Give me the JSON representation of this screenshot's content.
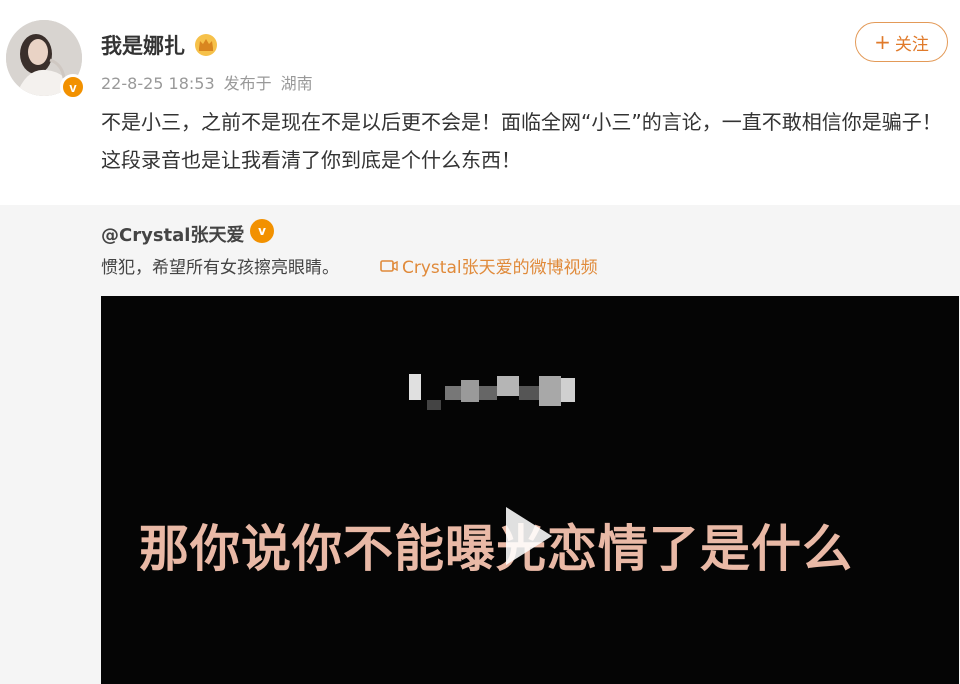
{
  "post": {
    "username": "我是娜扎",
    "timestamp": "22-8-25 18:53",
    "source": "发布于",
    "location": "湖南",
    "follow_plus": "+",
    "follow_label": "关注",
    "verified_mark": "v",
    "text": "不是小三，之前不是现在不是以后更不会是！面临全网“小三”的言论，一直不敢相信你是骗子！这段录音也是让我看清了你到底是个什么东西！"
  },
  "retweet": {
    "author": "@Crystal张天爱",
    "verified_mark": "v",
    "text": "惯犯，希望所有女孩擦亮眼睛。",
    "video_link": "Crystal张天爱的微博视频"
  },
  "video": {
    "subtitle": "那你说你不能曝光恋情了是什么",
    "subtitle_color": "#e9b9a6"
  },
  "colors": {
    "accent": "#e07a2a",
    "verified": "#f29100",
    "link": "#e08a3a",
    "retweet_bg": "#f5f5f5"
  }
}
